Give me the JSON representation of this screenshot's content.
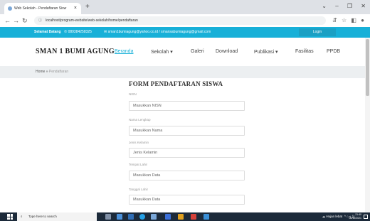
{
  "browser": {
    "tab_title": "Web Sekolah - Pendaftaran Sisw",
    "tab_close": "×",
    "new_tab": "+",
    "window_controls": "⌄ – ❐ ✕",
    "back": "←",
    "forward": "→",
    "reload": "↻",
    "url": "localhost/program-website/web-sekolah/home/pendaftaran",
    "toolbar_icons": "⇵ ☆ ◧ ●"
  },
  "topbar": {
    "greeting": "Selamat Datang",
    "phone": "089384258325",
    "email": "sman1bumiagung@yahoo.co.id / smansabumiagung@gmail.com",
    "login_label": "Login"
  },
  "header": {
    "brand": "SMAN 1 BUMI AGUNG",
    "nav": [
      {
        "label": "Beranda"
      },
      {
        "label": "Sekolah ▾"
      },
      {
        "label": "Galeri"
      },
      {
        "label": "Download"
      },
      {
        "label": "Publikasi ▾"
      },
      {
        "label": "Fasilitas"
      },
      {
        "label": "PPDB"
      }
    ]
  },
  "breadcrumb": {
    "home": "Home",
    "sep": " » ",
    "current": "Pendaftaran"
  },
  "form": {
    "title": "FORM PENDAFTARAN SISWA",
    "fields": [
      {
        "label": "NISN",
        "placeholder": "Masukkan NISN"
      },
      {
        "label": "Nama Lengkap",
        "placeholder": "Masukkan Nama"
      },
      {
        "label": "Jenis Kelamin",
        "placeholder": "Jenis Kelamin"
      },
      {
        "label": "Tempat Lahir",
        "placeholder": "Masukkan Data"
      },
      {
        "label": "Tanggal Lahir",
        "placeholder": "Masukkan Data"
      }
    ]
  },
  "taskbar": {
    "search_placeholder": "Type here to search",
    "tray_text": "Hujan lebat",
    "tray_icons": "^ ⌂ ◐ ))",
    "time": "21:40",
    "date": "06/10/2021"
  },
  "colors": {
    "accent": "#17b0d8",
    "taskbar": "#1c2a3a"
  }
}
